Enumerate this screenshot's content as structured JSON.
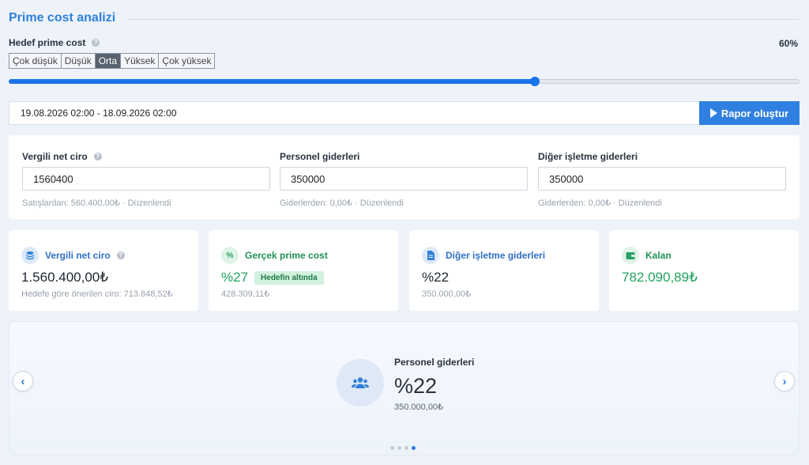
{
  "header": {
    "title": "Prime cost analizi"
  },
  "target": {
    "label": "Hedef prime cost",
    "percent_label": "60%",
    "slider_value": 0.665,
    "levels": [
      "Çok düşük",
      "Düşük",
      "Orta",
      "Yüksek",
      "Çok yüksek"
    ],
    "active_level": "Orta"
  },
  "report": {
    "date_range": "19.08.2026 02:00 - 18.09.2026 02:00",
    "button_label": "Rapor oluştur"
  },
  "inputs": {
    "revenue": {
      "label": "Vergili net ciro",
      "value": "1560400",
      "hint": "Satışlardan: 560.400,00₺ · Düzenlendi"
    },
    "personnel": {
      "label": "Personel giderleri",
      "value": "350000",
      "hint": "Giderlerden: 0,00₺ · Düzenlendi"
    },
    "other": {
      "label": "Diğer işletme giderleri",
      "value": "350000",
      "hint": "Giderlerden: 0,00₺ · Düzenlendi"
    }
  },
  "stats": {
    "revenue": {
      "label": "Vergili net ciro",
      "value": "1.560.400,00₺",
      "sub": "Hedefe göre önerilen ciro: 713.848,52₺"
    },
    "prime_cost": {
      "label": "Gerçek prime cost",
      "value": "%27",
      "badge": "Hedefin altında",
      "sub": "428.309,11₺"
    },
    "other": {
      "label": "Diğer işletme giderleri",
      "value": "%22",
      "sub": "350.000,00₺"
    },
    "remaining": {
      "label": "Kalan",
      "value": "782.090,89₺"
    }
  },
  "carousel": {
    "label": "Personel giderleri",
    "value": "%22",
    "sub": "350.000,00₺",
    "slide_count": 4,
    "active_slide": 4
  },
  "colors": {
    "accent": "#2f80d9",
    "positive": "#21a35f",
    "slider": "#1a73e8"
  },
  "icons": {
    "help": "question-circle-icon",
    "revenue": "coins-icon",
    "prime_cost": "percent-icon",
    "other": "document-icon",
    "remaining": "wallet-icon",
    "carousel": "users-icon"
  }
}
